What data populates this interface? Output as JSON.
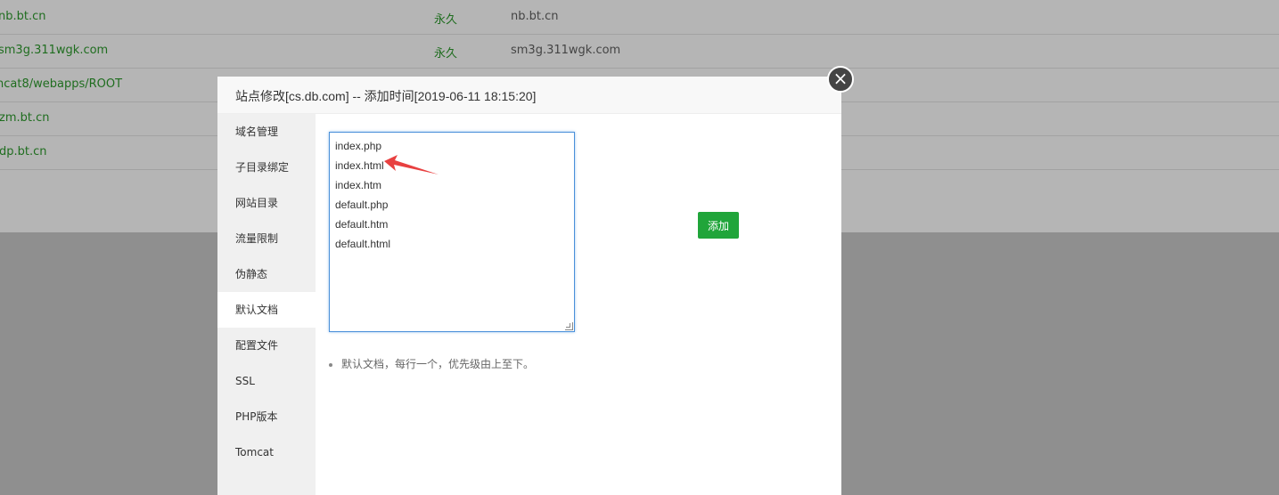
{
  "site_list": {
    "rows": [
      {
        "name": "nb.bt.cn",
        "expiry": "永久",
        "remark": "nb.bt.cn"
      },
      {
        "name": "sm3g.311wgk.com",
        "expiry": "永久",
        "remark": "sm3g.311wgk.com"
      },
      {
        "name": "ncat8/webapps/ROOT",
        "expiry": "",
        "remark": ""
      },
      {
        "name": "zm.bt.cn",
        "expiry": "",
        "remark": ""
      },
      {
        "name": "dp.bt.cn",
        "expiry": "",
        "remark": ""
      }
    ]
  },
  "modal": {
    "title": "站点修改[cs.db.com] -- 添加时间[2019-06-11 18:15:20]",
    "close_icon": "×",
    "sidebar": [
      {
        "label": "域名管理",
        "active": false
      },
      {
        "label": "子目录绑定",
        "active": false
      },
      {
        "label": "网站目录",
        "active": false
      },
      {
        "label": "流量限制",
        "active": false
      },
      {
        "label": "伪静态",
        "active": false
      },
      {
        "label": "默认文档",
        "active": true
      },
      {
        "label": "配置文件",
        "active": false
      },
      {
        "label": "SSL",
        "active": false
      },
      {
        "label": "PHP版本",
        "active": false
      },
      {
        "label": "Tomcat",
        "active": false
      }
    ],
    "default_docs": [
      "index.php",
      "index.html",
      "index.htm",
      "default.php",
      "default.htm",
      "default.html"
    ],
    "add_button": "添加",
    "tip": "默认文档，每行一个，优先级由上至下。"
  },
  "colors": {
    "accent": "#20a53a",
    "arrow": "#e84040"
  }
}
